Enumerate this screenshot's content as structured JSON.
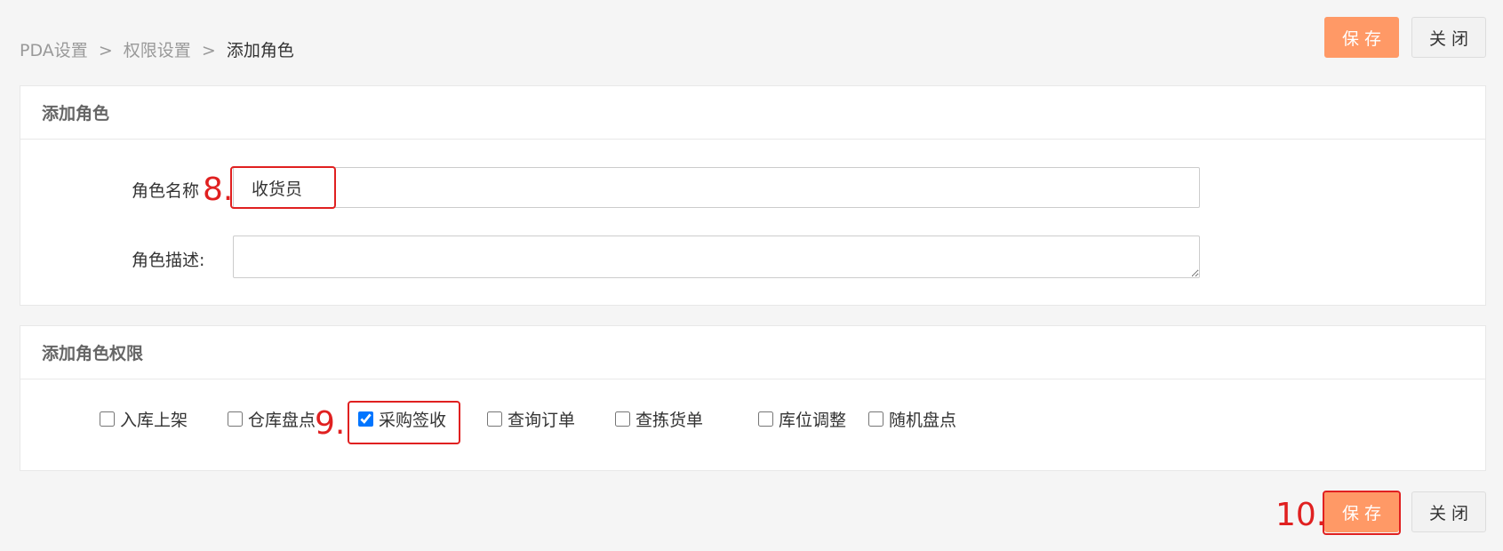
{
  "breadcrumb": {
    "items": [
      "PDA设置",
      "权限设置",
      "添加角色"
    ],
    "separator": ">"
  },
  "toolbar": {
    "save_label": "保存",
    "close_label": "关闭"
  },
  "role_panel": {
    "title": "添加角色",
    "name_label": "角色名称",
    "name_value": "收货员",
    "desc_label": "角色描述:",
    "desc_value": ""
  },
  "perm_panel": {
    "title": "添加角色权限",
    "items": [
      {
        "label": "入库上架",
        "checked": false
      },
      {
        "label": "仓库盘点",
        "checked": false
      },
      {
        "label": "采购签收",
        "checked": true
      },
      {
        "label": "查询订单",
        "checked": false
      },
      {
        "label": "查拣货单",
        "checked": false
      },
      {
        "label": "库位调整",
        "checked": false
      },
      {
        "label": "随机盘点",
        "checked": false
      }
    ]
  },
  "footer": {
    "save_label": "保存",
    "close_label": "关闭"
  },
  "annotations": {
    "step8": "8.",
    "step9": "9.",
    "step10": "10."
  },
  "colors": {
    "accent": "#ff9966",
    "annotation": "#e02020",
    "background": "#f5f5f5"
  }
}
